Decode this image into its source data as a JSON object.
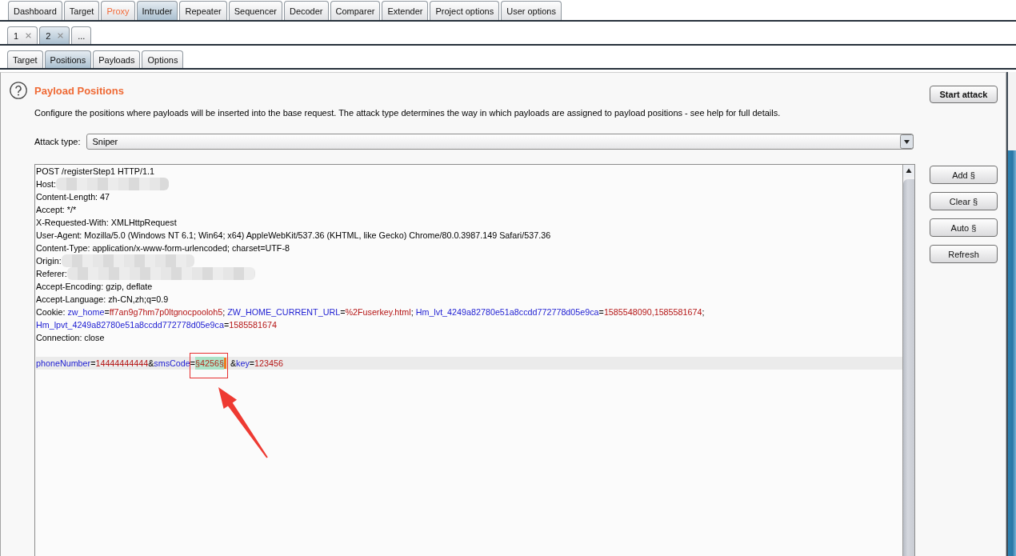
{
  "main_tabs": [
    {
      "label": "Dashboard",
      "selected": false,
      "highlighted": false
    },
    {
      "label": "Target",
      "selected": false,
      "highlighted": false
    },
    {
      "label": "Proxy",
      "selected": false,
      "highlighted": true
    },
    {
      "label": "Intruder",
      "selected": true,
      "highlighted": false
    },
    {
      "label": "Repeater",
      "selected": false,
      "highlighted": false
    },
    {
      "label": "Sequencer",
      "selected": false,
      "highlighted": false
    },
    {
      "label": "Decoder",
      "selected": false,
      "highlighted": false
    },
    {
      "label": "Comparer",
      "selected": false,
      "highlighted": false
    },
    {
      "label": "Extender",
      "selected": false,
      "highlighted": false
    },
    {
      "label": "Project options",
      "selected": false,
      "highlighted": false
    },
    {
      "label": "User options",
      "selected": false,
      "highlighted": false
    }
  ],
  "attack_tabs": [
    {
      "label": "1",
      "selected": false,
      "closable": true
    },
    {
      "label": "2",
      "selected": true,
      "closable": true
    },
    {
      "label": "...",
      "selected": false,
      "closable": false
    }
  ],
  "sub_tabs": [
    {
      "label": "Target",
      "selected": false
    },
    {
      "label": "Positions",
      "selected": true
    },
    {
      "label": "Payloads",
      "selected": false
    },
    {
      "label": "Options",
      "selected": false
    }
  ],
  "section": {
    "title": "Payload Positions",
    "description": "Configure the positions where payloads will be inserted into the base request. The attack type determines the way in which payloads are assigned to payload positions - see help for full details.",
    "attack_type": {
      "label": "Attack type:",
      "value": "Sniper"
    }
  },
  "start_attack": "Start attack",
  "position_buttons": [
    "Add §",
    "Clear §",
    "Auto §",
    "Refresh"
  ],
  "editor": {
    "lines": [
      {
        "current": false,
        "parts": [
          {
            "kind": "text",
            "tokens": [
              {
                "kind": "plain",
                "text": "POST /registerStep1 HTTP/1.1"
              }
            ]
          }
        ]
      },
      {
        "current": false,
        "parts": [
          {
            "kind": "text",
            "tokens": [
              {
                "kind": "plain",
                "text": "Host:"
              }
            ]
          },
          {
            "kind": "redacted"
          }
        ]
      },
      {
        "current": false,
        "parts": [
          {
            "kind": "text",
            "tokens": [
              {
                "kind": "plain",
                "text": "Content-Length: 47"
              }
            ]
          }
        ]
      },
      {
        "current": false,
        "parts": [
          {
            "kind": "text",
            "tokens": [
              {
                "kind": "plain",
                "text": "Accept: */*"
              }
            ]
          }
        ]
      },
      {
        "current": false,
        "parts": [
          {
            "kind": "text",
            "tokens": [
              {
                "kind": "plain",
                "text": "X-Requested-With: XMLHttpRequest"
              }
            ]
          }
        ]
      },
      {
        "current": false,
        "parts": [
          {
            "kind": "text",
            "tokens": [
              {
                "kind": "plain",
                "text": "User-Agent: Mozilla/5.0 (Windows NT 6.1; Win64; x64) AppleWebKit/537.36 (KHTML, like Gecko) Chrome/80.0.3987.149 Safari/537.36"
              }
            ]
          }
        ]
      },
      {
        "current": false,
        "parts": [
          {
            "kind": "text",
            "tokens": [
              {
                "kind": "plain",
                "text": "Content-Type: application/x-www-form-urlencoded; charset=UTF-8"
              }
            ]
          }
        ]
      },
      {
        "current": false,
        "parts": [
          {
            "kind": "text",
            "tokens": [
              {
                "kind": "plain",
                "text": "Origin:"
              }
            ]
          },
          {
            "kind": "redacted"
          }
        ]
      },
      {
        "current": false,
        "parts": [
          {
            "kind": "text",
            "tokens": [
              {
                "kind": "plain",
                "text": "Referer:"
              }
            ]
          },
          {
            "kind": "redacted"
          }
        ]
      },
      {
        "current": false,
        "parts": [
          {
            "kind": "text",
            "tokens": [
              {
                "kind": "plain",
                "text": "Accept-Encoding: gzip, deflate"
              }
            ]
          }
        ]
      },
      {
        "current": false,
        "parts": [
          {
            "kind": "text",
            "tokens": [
              {
                "kind": "plain",
                "text": "Accept-Language: zh-CN,zh;q=0.9"
              }
            ]
          }
        ]
      },
      {
        "current": false,
        "parts": [
          {
            "kind": "text",
            "tokens": [
              {
                "kind": "plain",
                "text": "Cookie: "
              },
              {
                "kind": "name",
                "text": "zw_home"
              },
              {
                "kind": "plain",
                "text": "="
              },
              {
                "kind": "value",
                "text": "ff7an9g7hm7p0ltgnocpooloh5"
              },
              {
                "kind": "plain",
                "text": "; "
              },
              {
                "kind": "name",
                "text": "ZW_HOME_CURRENT_URL"
              },
              {
                "kind": "plain",
                "text": "="
              },
              {
                "kind": "value",
                "text": "%2Fuserkey.html"
              },
              {
                "kind": "plain",
                "text": "; "
              },
              {
                "kind": "name",
                "text": "Hm_lvt_4249a82780e51a8ccdd772778d05e9ca"
              },
              {
                "kind": "plain",
                "text": "="
              },
              {
                "kind": "value",
                "text": "1585548090,1585581674"
              },
              {
                "kind": "plain",
                "text": ";"
              }
            ]
          }
        ]
      },
      {
        "current": false,
        "parts": [
          {
            "kind": "text",
            "tokens": [
              {
                "kind": "name",
                "text": "Hm_lpvt_4249a82780e51a8ccdd772778d05e9ca"
              },
              {
                "kind": "plain",
                "text": "="
              },
              {
                "kind": "value",
                "text": "1585581674"
              }
            ]
          }
        ]
      },
      {
        "current": false,
        "parts": [
          {
            "kind": "text",
            "tokens": [
              {
                "kind": "plain",
                "text": "Connection: close"
              }
            ]
          }
        ]
      },
      {
        "current": false
      },
      {
        "current": true,
        "parts": [
          {
            "kind": "text",
            "tokens": [
              {
                "kind": "name",
                "text": "phoneNumber"
              },
              {
                "kind": "plain",
                "text": "="
              },
              {
                "kind": "value",
                "text": "14444444444"
              },
              {
                "kind": "plain",
                "text": "&"
              },
              {
                "kind": "name",
                "text": "smsCode"
              },
              {
                "kind": "plain",
                "text": "="
              }
            ]
          },
          {
            "kind": "payload",
            "text": "§4256§",
            "framed": true,
            "pointed_at": true
          },
          {
            "kind": "cursor"
          },
          {
            "kind": "text",
            "tokens": [
              {
                "kind": "plain",
                "text": "&"
              },
              {
                "kind": "name",
                "text": "key"
              },
              {
                "kind": "plain",
                "text": "="
              },
              {
                "kind": "value",
                "text": "123456"
              }
            ]
          }
        ]
      }
    ]
  }
}
